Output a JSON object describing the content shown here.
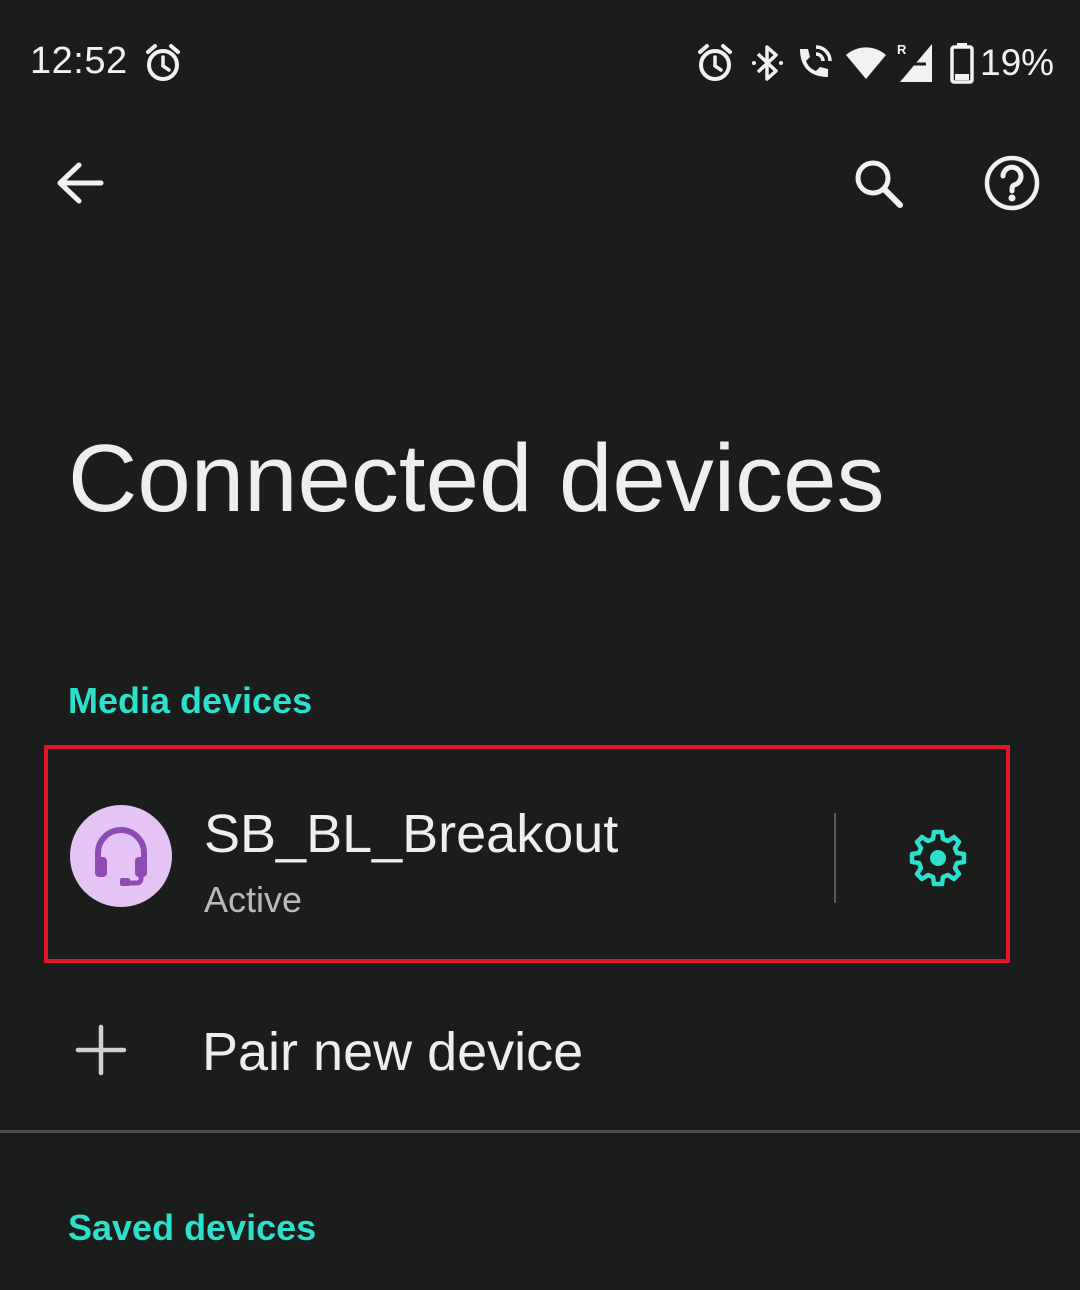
{
  "status_bar": {
    "time": "12:52",
    "battery_percent": "19%",
    "icons": [
      "alarm-icon",
      "alarm-icon",
      "bluetooth-icon",
      "wifi-calling-icon",
      "wifi-icon",
      "signal-roaming-icon",
      "battery-icon"
    ]
  },
  "app_bar": {
    "back_icon": "arrow-back-icon",
    "search_icon": "search-icon",
    "help_icon": "help-icon"
  },
  "page": {
    "title": "Connected devices"
  },
  "media_section": {
    "header": "Media devices",
    "devices": [
      {
        "name": "SB_BL_Breakout",
        "status": "Active",
        "icon": "headset-icon",
        "settings_icon": "gear-icon"
      }
    ]
  },
  "pair_new": {
    "label": "Pair new device",
    "icon": "plus-icon"
  },
  "saved_section": {
    "header": "Saved devices"
  },
  "colors": {
    "background": "#1b1c1c",
    "accent": "#2de0cc",
    "highlight_border": "#e0162a",
    "avatar_bg": "#e6c3f5",
    "avatar_icon": "#8e4bb3"
  }
}
